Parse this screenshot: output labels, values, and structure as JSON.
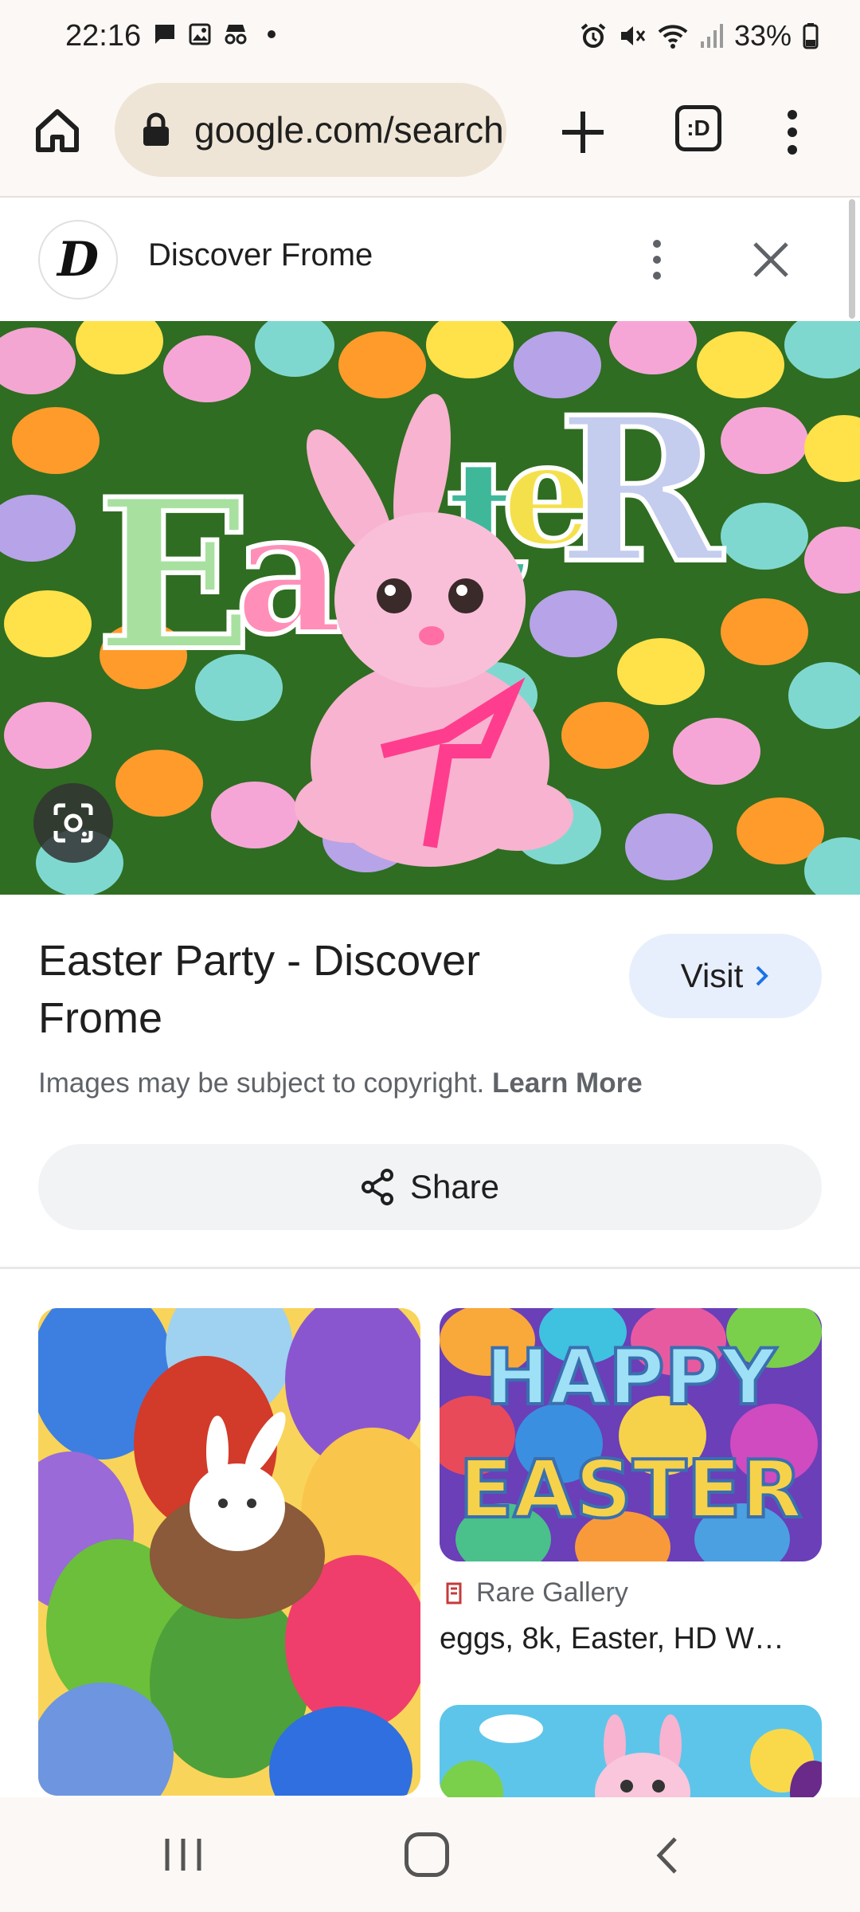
{
  "status_bar": {
    "time": "22:16",
    "battery": "33%",
    "left_icons": [
      "chat-icon",
      "gallery-icon",
      "incognito-icon",
      "dot-icon"
    ],
    "right_icons": [
      "alarm-icon",
      "mute-icon",
      "wifi-icon",
      "signal-icon",
      "battery-icon"
    ]
  },
  "browser": {
    "url": "google.com/search",
    "tab_indicator": ":D"
  },
  "panel": {
    "site_name": "Discover Frome",
    "logo_letter": "D"
  },
  "hero": {
    "letters": [
      "E",
      "a",
      "s",
      "t",
      "e",
      "R"
    ]
  },
  "result": {
    "title": "Easter Party - Discover Frome",
    "visit_label": "Visit",
    "copyright_text": "Images may be subject to copyright.",
    "learn_more": "Learn More",
    "share_label": "Share"
  },
  "related": {
    "card2_text": [
      "HAPPY",
      "EASTER"
    ],
    "source": "Rare Gallery",
    "title": "eggs, 8k, Easter, HD W…"
  },
  "colors": {
    "status_bg": "#fcf8f5",
    "url_bg": "#eee5d6",
    "visit_bg": "#e8effc",
    "visit_chevron": "#1a73e8",
    "share_bg": "#f1f3f4"
  }
}
